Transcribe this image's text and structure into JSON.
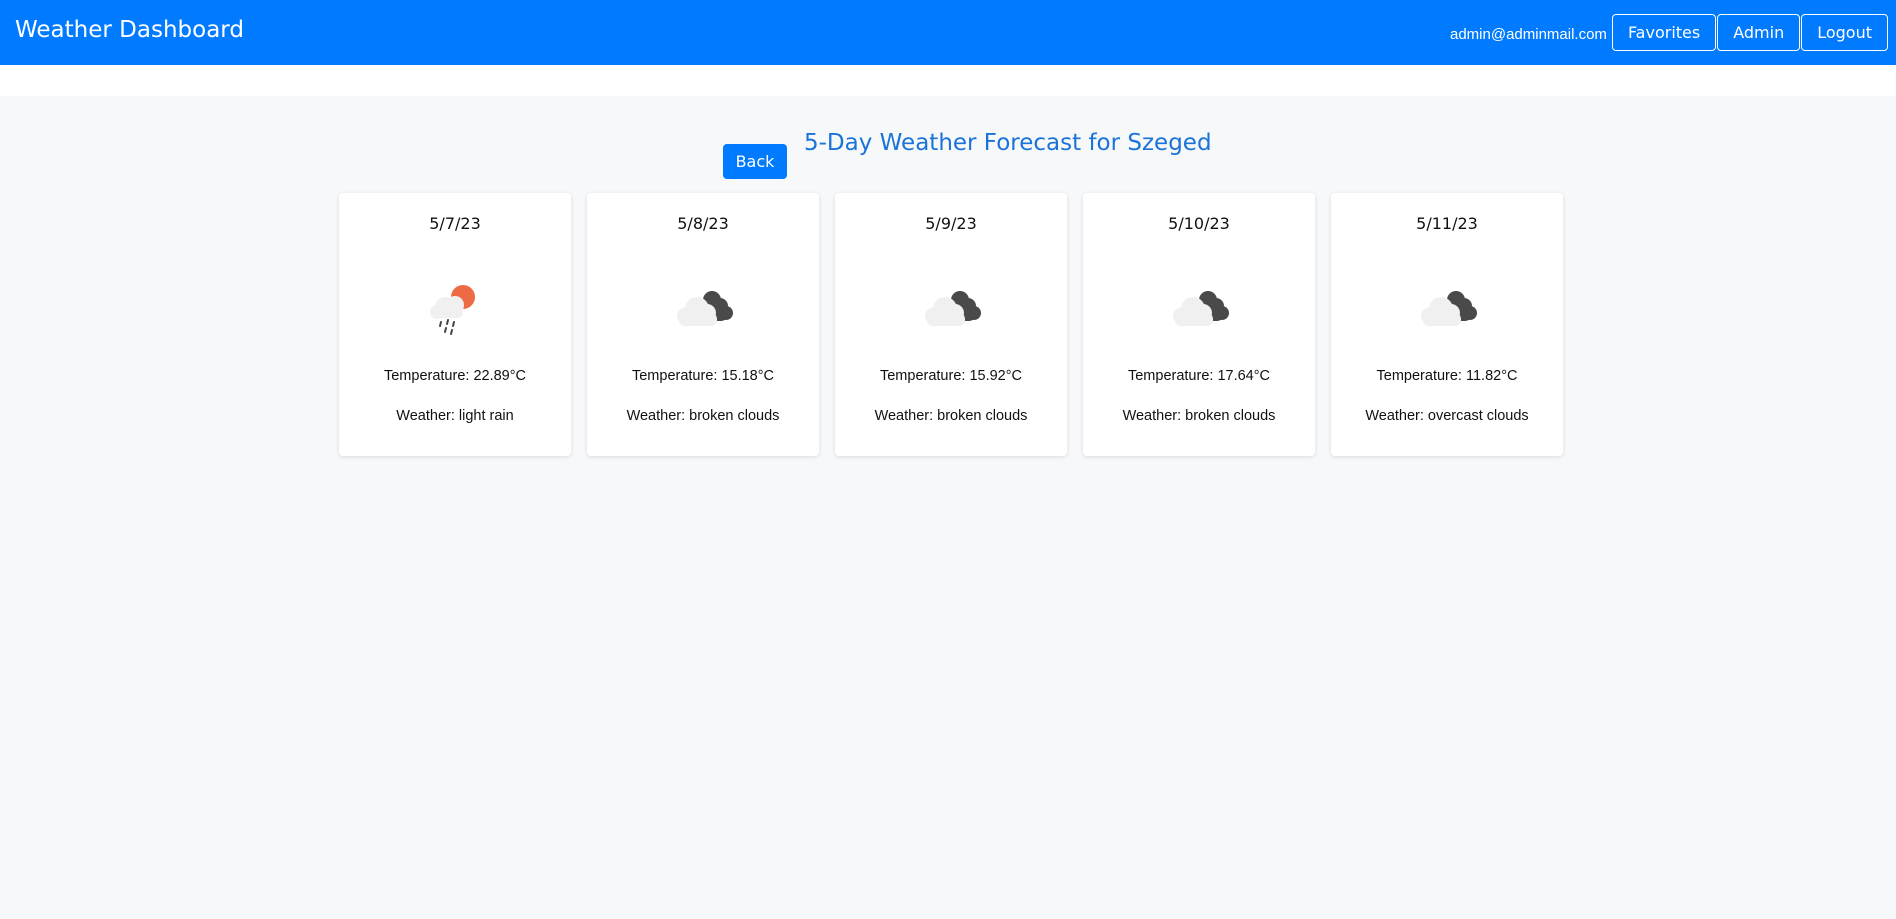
{
  "app": {
    "title": "Weather Dashboard"
  },
  "header": {
    "user_email": "admin@adminmail.com",
    "buttons": {
      "favorites": "Favorites",
      "admin": "Admin",
      "logout": "Logout"
    },
    "bg_color": "#007bff"
  },
  "forecast": {
    "back_label": "Back",
    "title": "5-Day Weather Forecast for Szeged",
    "days": [
      {
        "date": "5/7/23",
        "temperature": "Temperature: 22.89°C",
        "weather": "Weather: light rain",
        "icon": "light-rain-icon"
      },
      {
        "date": "5/8/23",
        "temperature": "Temperature: 15.18°C",
        "weather": "Weather: broken clouds",
        "icon": "broken-clouds-icon"
      },
      {
        "date": "5/9/23",
        "temperature": "Temperature: 15.92°C",
        "weather": "Weather: broken clouds",
        "icon": "broken-clouds-icon"
      },
      {
        "date": "5/10/23",
        "temperature": "Temperature: 17.64°C",
        "weather": "Weather: broken clouds",
        "icon": "broken-clouds-icon"
      },
      {
        "date": "5/11/23",
        "temperature": "Temperature: 11.82°C",
        "weather": "Weather: overcast clouds",
        "icon": "overcast-clouds-icon"
      }
    ]
  }
}
